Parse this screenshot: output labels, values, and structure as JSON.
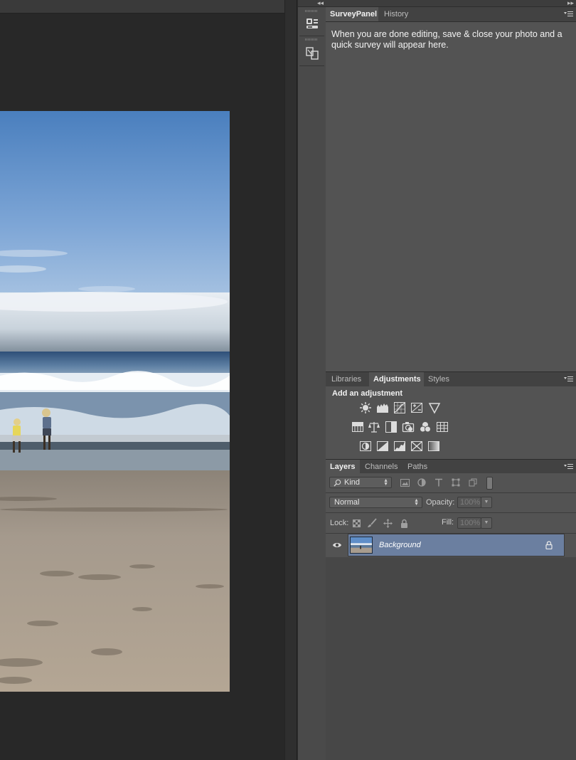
{
  "survey_panel": {
    "tabs": [
      {
        "label": "SurveyPanel",
        "active": true
      },
      {
        "label": "History",
        "active": false
      }
    ],
    "message": "When you are done editing, save & close your photo and a quick survey will appear here."
  },
  "adjustments_panel": {
    "tabs": [
      {
        "label": "Libraries",
        "active": false
      },
      {
        "label": "Adjustments",
        "active": true
      },
      {
        "label": "Styles",
        "active": false
      }
    ],
    "title": "Add an adjustment",
    "icons": {
      "row1": [
        "brightness-contrast-icon",
        "levels-icon",
        "curves-icon",
        "exposure-icon",
        "vibrance-icon"
      ],
      "row2": [
        "hue-saturation-icon",
        "color-balance-icon",
        "black-white-icon",
        "photo-filter-icon",
        "channel-mixer-icon",
        "color-lookup-icon"
      ],
      "row3": [
        "invert-icon",
        "posterize-icon",
        "threshold-icon",
        "selective-color-icon",
        "gradient-map-icon"
      ]
    }
  },
  "layers_panel": {
    "tabs": [
      {
        "label": "Layers",
        "active": true
      },
      {
        "label": "Channels",
        "active": false
      },
      {
        "label": "Paths",
        "active": false
      }
    ],
    "filter_kind": "Kind",
    "blend_mode": "Normal",
    "opacity_label": "Opacity:",
    "opacity_value": "100%",
    "lock_label": "Lock:",
    "fill_label": "Fill:",
    "fill_value": "100%",
    "layers": [
      {
        "name": "Background",
        "visible": true,
        "locked": true,
        "selected": true
      }
    ]
  },
  "colors": {
    "selected_layer": "#6b7fa0",
    "panel_bg": "#535353",
    "canvas_bg": "#282828"
  }
}
